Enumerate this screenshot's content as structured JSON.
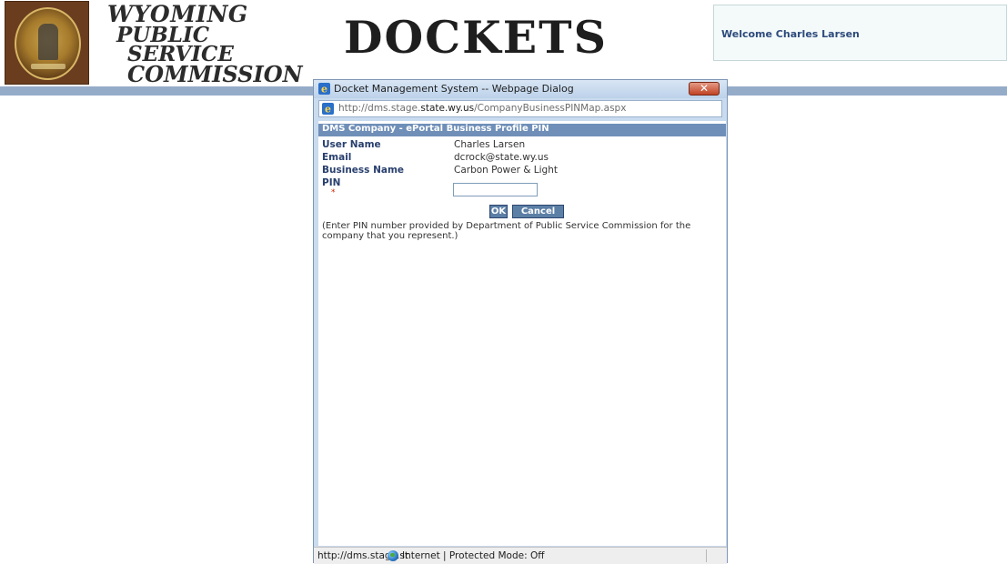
{
  "header": {
    "brand_lines": [
      "WYOMING",
      "PUBLIC",
      "SERVICE",
      "COMMISSION"
    ],
    "dockets_title": "DOCKETS",
    "welcome_text": "Welcome Charles Larsen"
  },
  "dialog": {
    "title": "Docket Management System -- Webpage Dialog",
    "close_label": "✕",
    "address": {
      "prefix": "http://dms.stage.",
      "domain": "state.wy.us",
      "path": "/CompanyBusinessPINMap.aspx"
    },
    "section_title": "DMS Company - ePortal Business Profile PIN",
    "fields": [
      {
        "label": "User Name",
        "value": "Charles Larsen"
      },
      {
        "label": "Email",
        "value": "dcrock@state.wy.us"
      },
      {
        "label": "Business Name",
        "value": "Carbon Power & Light"
      }
    ],
    "pin": {
      "label": "PIN",
      "required_marker": "*",
      "value": ""
    },
    "buttons": {
      "ok": "OK",
      "cancel": "Cancel"
    },
    "note": "(Enter PIN number provided by Department of Public Service Commission for the company that you represent.)",
    "status": {
      "url": "http://dms.stage.st",
      "zone": "Internet | Protected Mode: Off"
    }
  },
  "colors": {
    "accent_bar": "#95acc9",
    "section_header": "#6f8fb8",
    "button": "#5c7fa6",
    "label_text": "#283f6e"
  }
}
